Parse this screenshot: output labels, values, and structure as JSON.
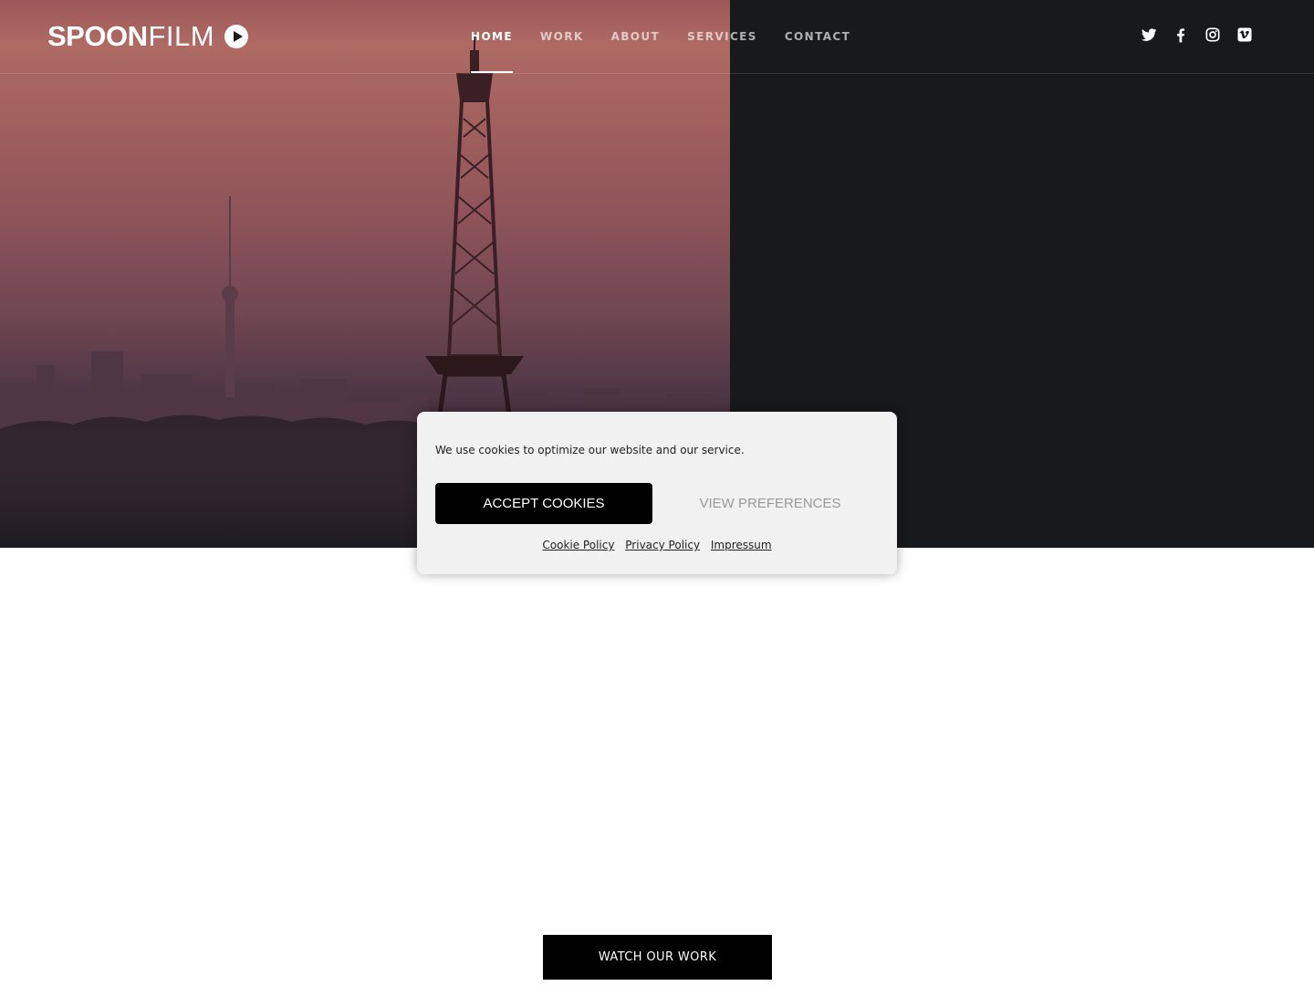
{
  "brand": {
    "logo_bold": "SPOON",
    "logo_light": "FILM",
    "play_icon": "play-circle-icon"
  },
  "nav": {
    "items": [
      {
        "label": "HOME",
        "active": true
      },
      {
        "label": "WORK"
      },
      {
        "label": "ABOUT"
      },
      {
        "label": "SERVICES"
      },
      {
        "label": "CONTACT"
      }
    ]
  },
  "social": {
    "icons": [
      "twitter-icon",
      "facebook-icon",
      "instagram-icon",
      "vimeo-icon"
    ]
  },
  "cookie": {
    "message": "We use cookies to optimize our website and our service.",
    "accept_label": "ACCEPT COOKIES",
    "prefs_label": "VIEW PREFERENCES",
    "links": {
      "cookie_policy": "Cookie Policy",
      "privacy_policy": "Privacy Policy",
      "impressum": "Impressum"
    }
  },
  "cta": {
    "watch_label": "WATCH OUR WORK"
  },
  "colors": {
    "dark": "#18191b",
    "accent": "#000000",
    "sky": "#9d5757"
  }
}
